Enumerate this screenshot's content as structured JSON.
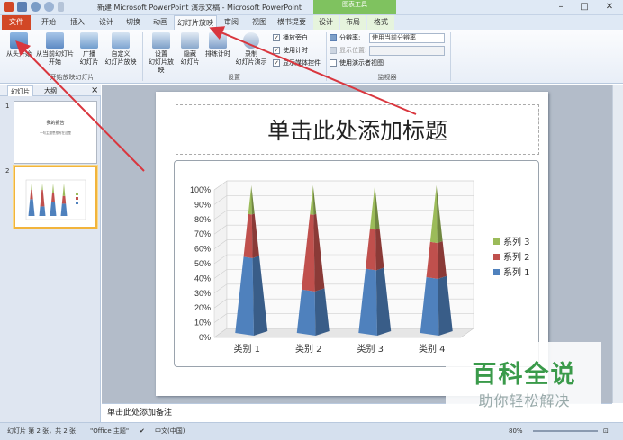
{
  "window": {
    "title": "新建 Microsoft PowerPoint 演示文稿 - Microsoft PowerPoint",
    "context_tools_label": "图表工具"
  },
  "tabs": [
    {
      "label": "文件"
    },
    {
      "label": "开始"
    },
    {
      "label": "插入"
    },
    {
      "label": "设计"
    },
    {
      "label": "切换"
    },
    {
      "label": "动画"
    },
    {
      "label": "幻灯片放映"
    },
    {
      "label": "审阅"
    },
    {
      "label": "视图"
    },
    {
      "label": "横书提要"
    },
    {
      "label": "设计"
    },
    {
      "label": "布局"
    },
    {
      "label": "格式"
    }
  ],
  "ribbon": {
    "start_group": {
      "from_start": "从头开始",
      "from_current_1": "从当前幻灯片",
      "from_current_2": "开始",
      "broadcast_1": "广播",
      "broadcast_2": "幻灯片",
      "custom_1": "自定义",
      "custom_2": "幻灯片放映",
      "label": "开始放映幻灯片"
    },
    "setup_group": {
      "setup_1": "设置",
      "setup_2": "幻灯片放映",
      "hide_1": "隐藏",
      "hide_2": "幻灯片",
      "rehearse": "排练计时",
      "record_1": "录制",
      "record_2": "幻灯片演示",
      "chk_narration": "播放旁白",
      "chk_timing": "使用计时",
      "chk_media": "显示媒体控件",
      "label": "设置"
    },
    "monitor_group": {
      "resolution_label": "分辨率:",
      "resolution_value": "使用当前分辨率",
      "display_label": "显示位置:",
      "presenter_view": "使用演示者视图",
      "label": "监视器"
    }
  },
  "left_pane": {
    "tab_slides": "幻灯片",
    "tab_outline": "大纲",
    "close": "×",
    "thumbs": [
      {
        "num": "1",
        "title": "我的报告",
        "subtitle": "一句主题思想写在这里"
      },
      {
        "num": "2"
      }
    ]
  },
  "slide": {
    "title_placeholder": "单击此处添加标题"
  },
  "chart_data": {
    "type": "bar",
    "subtype": "stacked-100-pyramid-3d",
    "categories": [
      "类别 1",
      "类别 2",
      "类别 3",
      "类别 4"
    ],
    "series": [
      {
        "name": "系列 1",
        "color": "#4f81bd",
        "values": [
          51.6,
          29.4,
          43.5,
          37.8
        ]
      },
      {
        "name": "系列 2",
        "color": "#c0504d",
        "values": [
          29.0,
          51.0,
          27.0,
          23.9
        ]
      },
      {
        "name": "系列 3",
        "color": "#9bbb59",
        "values": [
          19.4,
          19.6,
          29.5,
          38.3
        ]
      }
    ],
    "ylim": [
      0,
      100
    ],
    "yticks": [
      "0%",
      "10%",
      "20%",
      "30%",
      "40%",
      "50%",
      "60%",
      "70%",
      "80%",
      "90%",
      "100%"
    ],
    "legend_position": "right",
    "grid": true
  },
  "notes": {
    "placeholder": "单击此处添加备注"
  },
  "status": {
    "slide_info": "幻灯片 第 2 张，共 2 张",
    "theme": "\"Office 主题\"",
    "language": "中文(中国)",
    "zoom": "80%"
  },
  "watermark": {
    "main": "百科全说",
    "sub": "助你轻松解决"
  },
  "colors": {
    "file_tab": "#d24726",
    "context_tab": "#7fc25f",
    "arrow": "#d9363e",
    "watermark_green": "#3a9a4a"
  }
}
